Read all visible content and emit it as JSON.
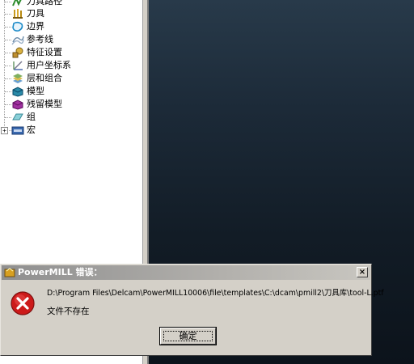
{
  "explorer": {
    "items": [
      {
        "label": "刀具路径",
        "icon": "toolpath-icon",
        "expandable": false
      },
      {
        "label": "刀具",
        "icon": "tool-icon",
        "expandable": false
      },
      {
        "label": "边界",
        "icon": "boundary-icon",
        "expandable": false
      },
      {
        "label": "参考线",
        "icon": "pattern-icon",
        "expandable": false
      },
      {
        "label": "特征设置",
        "icon": "featureset-icon",
        "expandable": false
      },
      {
        "label": "用户坐标系",
        "icon": "workplane-icon",
        "expandable": false
      },
      {
        "label": "层和组合",
        "icon": "levels-icon",
        "expandable": false
      },
      {
        "label": "模型",
        "icon": "model-icon",
        "expandable": false
      },
      {
        "label": "残留模型",
        "icon": "stockmodel-icon",
        "expandable": false
      },
      {
        "label": "组",
        "icon": "group-icon",
        "expandable": false
      },
      {
        "label": "宏",
        "icon": "macro-icon",
        "expandable": true,
        "expander": "+"
      }
    ]
  },
  "dialog": {
    "title": "PowerMILL 错误：",
    "close": "×",
    "path": "D:\\Program Files\\Delcam\\PowerMILL10006\\file\\templates\\C:\\dcam\\pmill2\\刀具库\\tool-L.ptf",
    "message": "文件不存在",
    "ok": "确定"
  },
  "colors": {
    "viewport_top": "#283a4a",
    "viewport_bottom": "#0c131b",
    "dialog_bg": "#d4d0c8",
    "error_red": "#cc1a1a"
  }
}
